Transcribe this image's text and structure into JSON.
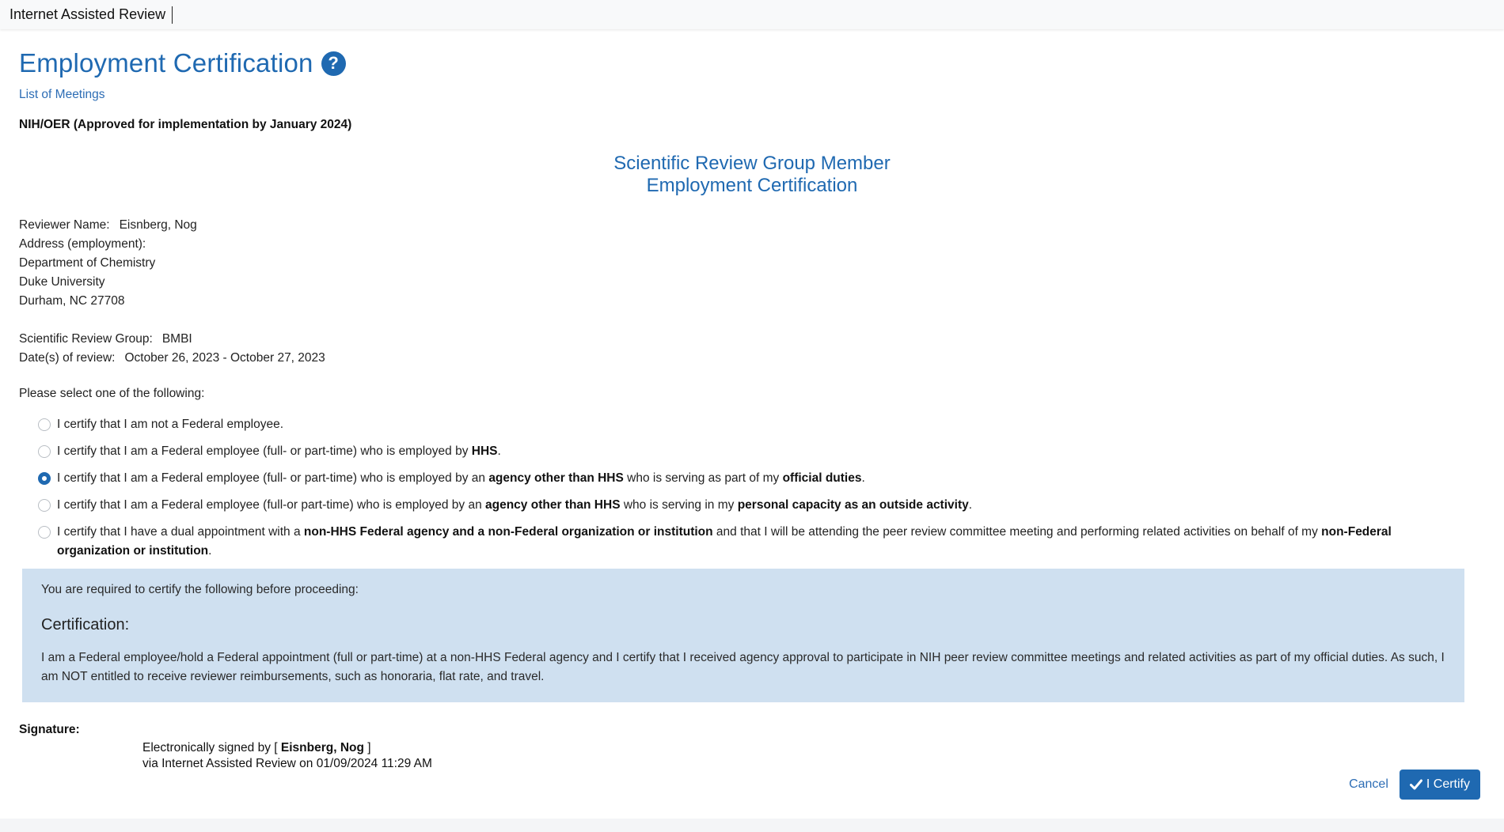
{
  "app": {
    "title": "Internet Assisted Review"
  },
  "page": {
    "title": "Employment Certification",
    "help_icon": "question-circle-icon",
    "breadcrumb_link": "List of Meetings",
    "approval_note": "NIH/OER (Approved for implementation by January 2024)"
  },
  "form": {
    "heading_line1": "Scientific Review Group Member",
    "heading_line2": "Employment Certification"
  },
  "reviewer": {
    "name_label": "Reviewer Name:",
    "name": "Eisnberg, Nog",
    "address_label": "Address (employment):",
    "address": [
      "Department of Chemistry",
      "Duke University",
      "Durham, NC 27708"
    ],
    "srg_label": "Scientific Review Group:",
    "srg": "BMBI",
    "dates_label": "Date(s) of review:",
    "dates": "October 26, 2023 - October 27, 2023"
  },
  "selection": {
    "prompt": "Please select one of the following:",
    "selected_index": 2,
    "options": [
      {
        "parts": [
          {
            "t": "I certify that I am not a Federal employee.",
            "b": false
          }
        ]
      },
      {
        "parts": [
          {
            "t": "I certify that I am a Federal employee (full- or part-time) who is employed by ",
            "b": false
          },
          {
            "t": "HHS",
            "b": true
          },
          {
            "t": ".",
            "b": false
          }
        ]
      },
      {
        "parts": [
          {
            "t": "I certify that I am a Federal employee (full- or part-time) who is employed by an ",
            "b": false
          },
          {
            "t": "agency other than HHS",
            "b": true
          },
          {
            "t": " who is serving as part of my ",
            "b": false
          },
          {
            "t": "official duties",
            "b": true
          },
          {
            "t": ".",
            "b": false
          }
        ]
      },
      {
        "parts": [
          {
            "t": "I certify that I am a Federal employee (full-or part-time) who is employed by an ",
            "b": false
          },
          {
            "t": "agency other than HHS",
            "b": true
          },
          {
            "t": " who is serving in my ",
            "b": false
          },
          {
            "t": "personal capacity as an outside activity",
            "b": true
          },
          {
            "t": ".",
            "b": false
          }
        ]
      },
      {
        "parts": [
          {
            "t": "I certify that I have a dual appointment with a ",
            "b": false
          },
          {
            "t": "non-HHS Federal agency and a non-Federal organization or institution",
            "b": true
          },
          {
            "t": " and that I will be attending the peer review committee meeting and performing related activities on behalf of my ",
            "b": false
          },
          {
            "t": "non-Federal organization or institution",
            "b": true
          },
          {
            "t": ".",
            "b": false
          }
        ]
      }
    ]
  },
  "certification": {
    "intro": "You are required to certify the following before proceeding:",
    "heading": "Certification:",
    "text": "I am a Federal employee/hold a Federal appointment (full or part-time) at a non-HHS Federal agency and I certify that I received agency approval to participate in NIH peer review committee meetings and related activities as part of my official duties. As such, I am NOT entitled to receive reviewer reimbursements, such as honoraria, flat rate, and travel."
  },
  "signature": {
    "label": "Signature:",
    "signed_prefix": "Electronically signed by [ ",
    "signer": "Eisnberg, Nog",
    "signed_suffix": " ]",
    "via_line": "via Internet Assisted Review on 01/09/2024 11:29 AM"
  },
  "actions": {
    "cancel_label": "Cancel",
    "certify_label": "I Certify",
    "certify_icon": "check-icon"
  },
  "colors": {
    "brand_blue": "#1f69b1",
    "link_blue": "#2d6db5",
    "cert_box_bg": "#cfe0f0"
  }
}
